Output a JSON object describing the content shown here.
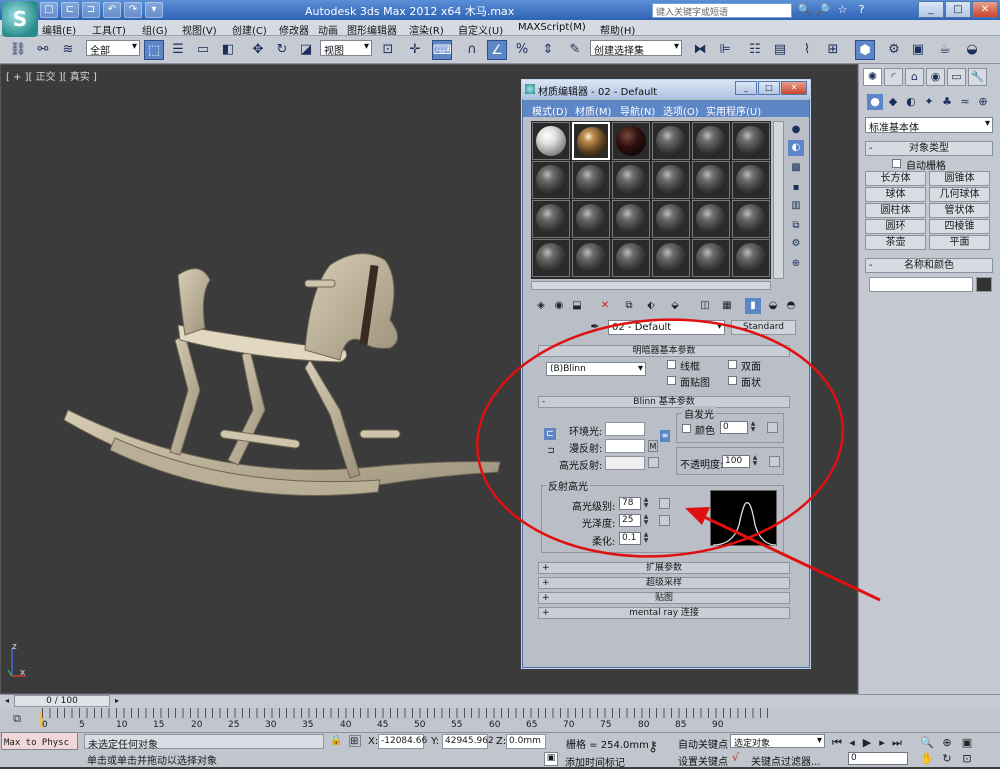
{
  "app": {
    "title": "Autodesk 3ds Max  2012 x64    木马.max",
    "logo": "S",
    "search_placeholder": "键入关键字或短语"
  },
  "quick_access": [
    "□",
    "⊏",
    "⊐",
    "↶",
    "↷",
    "▾"
  ],
  "title_icons": [
    "🔍",
    "🔎",
    "☆",
    "?"
  ],
  "window_controls": {
    "minimize": "_",
    "maximize": "□",
    "close": "✕"
  },
  "menu": [
    "编辑(E)",
    "工具(T)",
    "组(G)",
    "视图(V)",
    "创建(C)",
    "修改器",
    "动画",
    "图形编辑器",
    "渲染(R)",
    "自定义(U)",
    "MAXScript(M)",
    "帮助(H)"
  ],
  "toolbar": {
    "filter_value": "全部",
    "view_value": "视图",
    "selection_set_value": "创建选择集"
  },
  "viewport": {
    "label": "[ + ][ 正交 ][ 真实 ]",
    "axis_z": "z",
    "axis_x": "x"
  },
  "command_panel": {
    "tabs": [
      "✺",
      "◜",
      "⌂",
      "◉",
      "▭",
      "🔧"
    ],
    "subtabs": [
      "●",
      "◆",
      "◐",
      "✦",
      "♣",
      "≈",
      "⊕"
    ],
    "category_value": "标准基本体",
    "object_type_header": "对象类型",
    "autogrid_label": "自动栅格",
    "objects": [
      [
        "长方体",
        "圆锥体"
      ],
      [
        "球体",
        "几何球体"
      ],
      [
        "圆柱体",
        "管状体"
      ],
      [
        "圆环",
        "四棱锥"
      ],
      [
        "茶壶",
        "平面"
      ]
    ],
    "name_color_header": "名称和颜色"
  },
  "material_editor": {
    "title": "材质编辑器 - 02 - Default",
    "menu": [
      "模式(D)",
      "材质(M)",
      "导航(N)",
      "选项(O)",
      "实用程序(U)"
    ],
    "material_name": "02 - Default",
    "material_type": "Standard",
    "shader_header": "明暗器基本参数",
    "shader_value": "(B)Blinn",
    "shader_options": [
      "线框",
      "双面",
      "面贴图",
      "面状"
    ],
    "blinn_header": "Blinn 基本参数",
    "self_illum_group": "自发光",
    "self_illum_color_label": "颜色",
    "self_illum_value": "0",
    "ambient_label": "环境光:",
    "diffuse_label": "漫反射:",
    "specular_label": "高光反射:",
    "m_button": "M",
    "opacity_label": "不透明度:",
    "opacity_value": "100",
    "specular_group": "反射高光",
    "spec_level_label": "高光级别:",
    "spec_level_value": "78",
    "glossiness_label": "光泽度:",
    "glossiness_value": "25",
    "soften_label": "柔化:",
    "soften_value": "0.1",
    "rollouts": [
      "扩展参数",
      "超级采样",
      "贴图",
      "mental ray 连接"
    ]
  },
  "timeline": {
    "frame_label": "0 / 100",
    "ticks": [
      "0",
      "5",
      "10",
      "15",
      "20",
      "25",
      "30",
      "35",
      "40",
      "45",
      "50",
      "55",
      "60",
      "65",
      "70",
      "75",
      "80",
      "85",
      "90"
    ]
  },
  "status": {
    "max_to_physc": "Max to Physc",
    "no_selection": "未选定任何对象",
    "hint": "单击或单击并拖动以选择对象",
    "x_label": "X:",
    "x_value": "-12084.66",
    "y_label": "Y:",
    "y_value": "42945.962",
    "z_label": "Z:",
    "z_value": "0.0mm",
    "grid": "栅格 = 254.0mm",
    "add_time_tag": "添加时间标记",
    "auto_key": "自动关键点",
    "set_key": "设置关键点",
    "key_selection_value": "选定对象",
    "key_filters": "关键点过滤器...",
    "frame_value": "0"
  }
}
